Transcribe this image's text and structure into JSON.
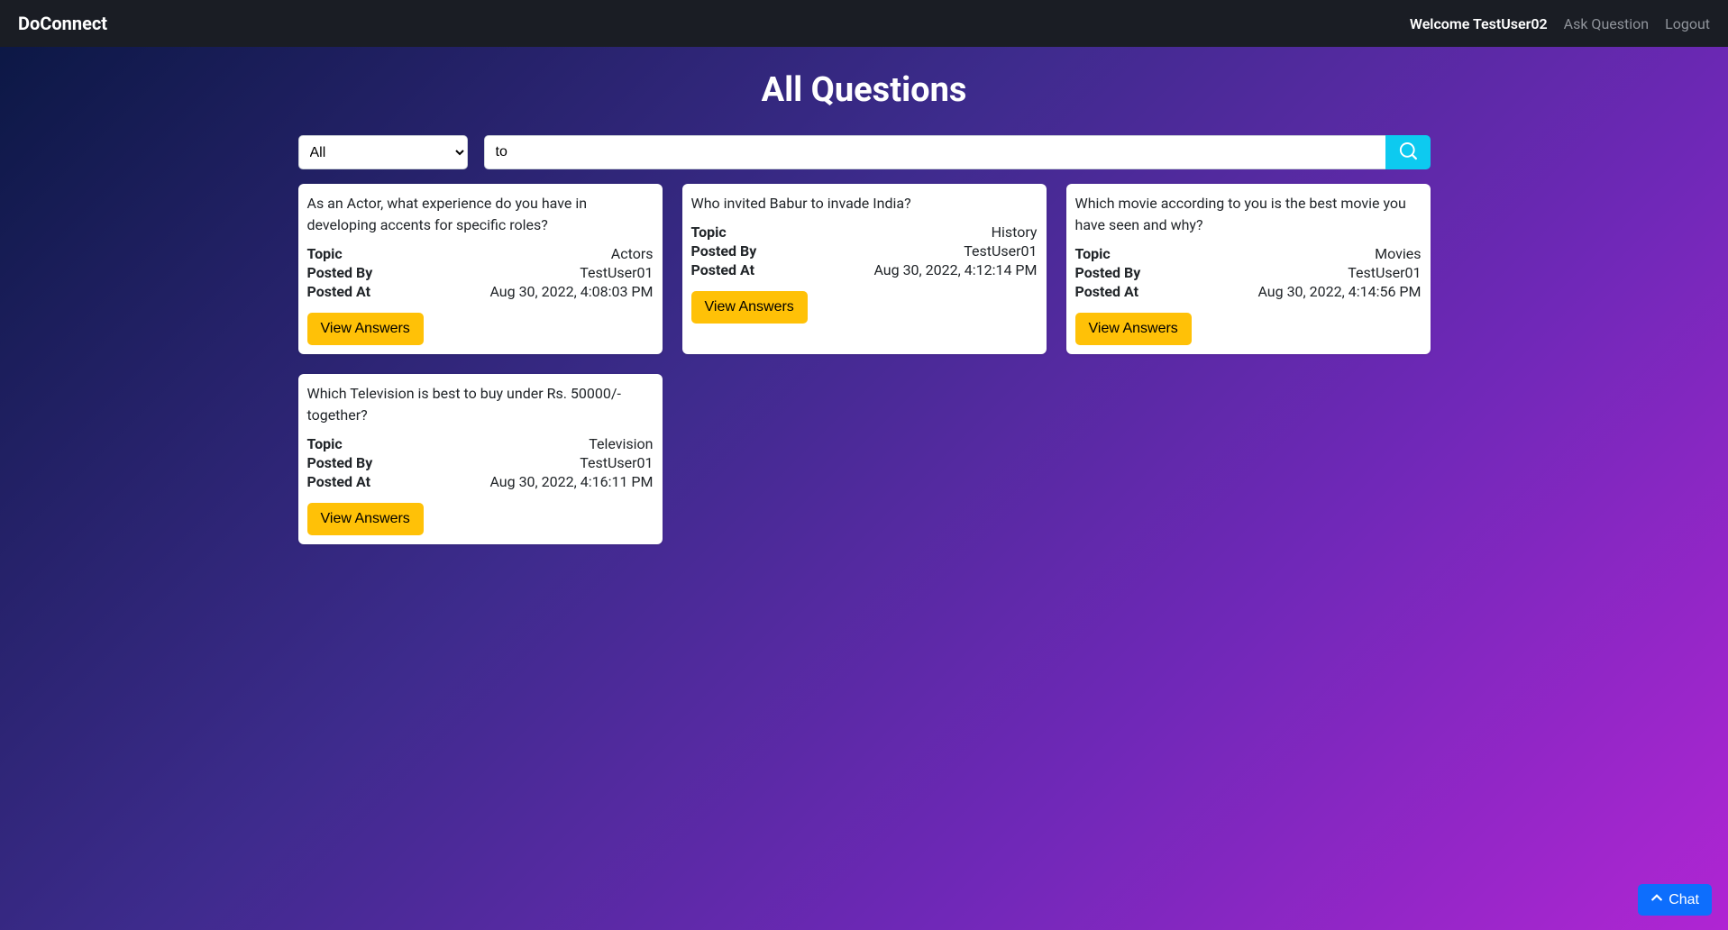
{
  "brand": "DoConnect",
  "welcome": "Welcome TestUser02",
  "nav": {
    "ask": "Ask Question",
    "logout": "Logout"
  },
  "page_title": "All Questions",
  "filter": {
    "selected": "All",
    "options": [
      "All"
    ]
  },
  "search": {
    "value": "to"
  },
  "labels": {
    "topic": "Topic",
    "posted_by": "Posted By",
    "posted_at": "Posted At",
    "view_answers": "View Answers"
  },
  "questions": [
    {
      "title": "As an Actor, what experience do you have in developing accents for specific roles?",
      "topic": "Actors",
      "posted_by": "TestUser01",
      "posted_at": "Aug 30, 2022, 4:08:03 PM"
    },
    {
      "title": "Who invited Babur to invade India?",
      "topic": "History",
      "posted_by": "TestUser01",
      "posted_at": "Aug 30, 2022, 4:12:14 PM"
    },
    {
      "title": "Which movie according to you is the best movie you have seen and why?",
      "topic": "Movies",
      "posted_by": "TestUser01",
      "posted_at": "Aug 30, 2022, 4:14:56 PM"
    },
    {
      "title": "Which Television is best to buy under Rs. 50000/- together?",
      "topic": "Television",
      "posted_by": "TestUser01",
      "posted_at": "Aug 30, 2022, 4:16:11 PM"
    }
  ],
  "chat_label": "Chat"
}
